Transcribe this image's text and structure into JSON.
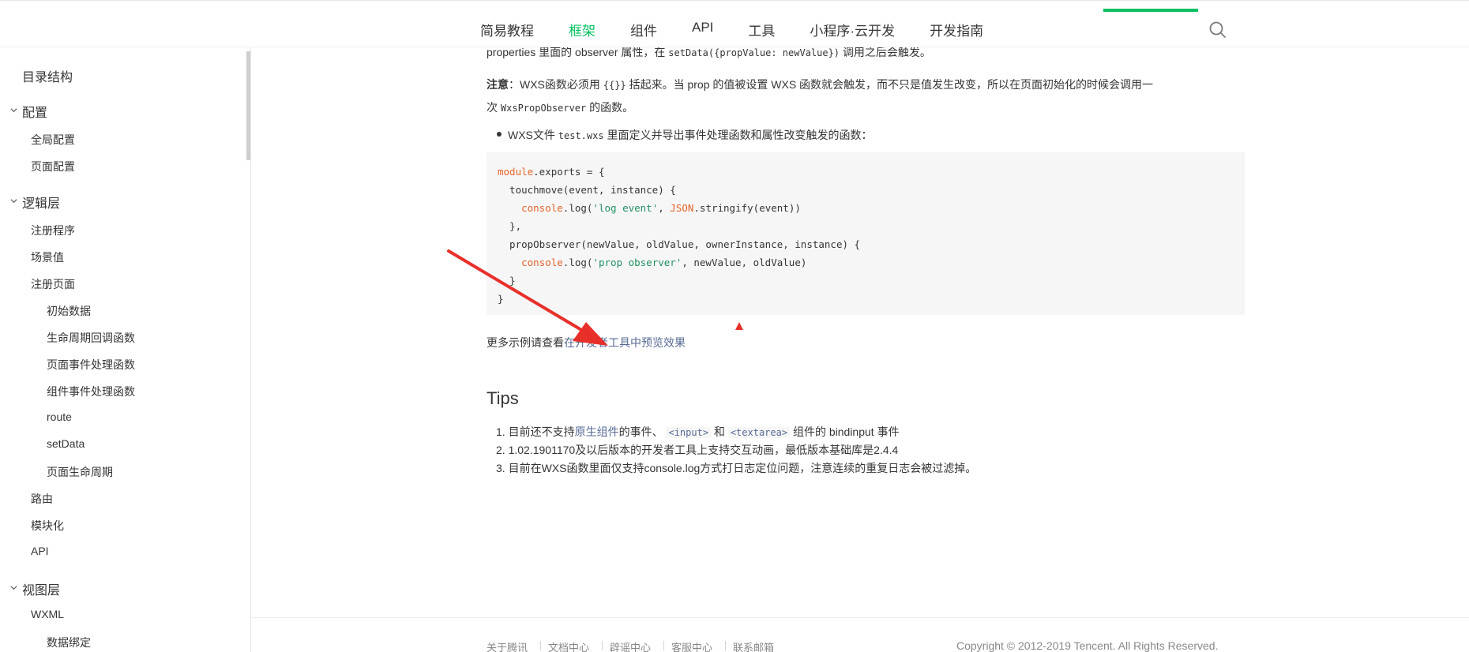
{
  "nav": {
    "items": [
      "简易教程",
      "框架",
      "组件",
      "API",
      "工具",
      "小程序·云开发",
      "开发指南"
    ],
    "active_index": 1
  },
  "sidebar": {
    "items": [
      {
        "label": "目录结构",
        "level": 0
      },
      {
        "label": "配置",
        "level": 0,
        "expanded": true
      },
      {
        "label": "全局配置",
        "level": 1
      },
      {
        "label": "页面配置",
        "level": 1
      },
      {
        "label": "逻辑层",
        "level": 0,
        "expanded": true
      },
      {
        "label": "注册程序",
        "level": 1
      },
      {
        "label": "场景值",
        "level": 1
      },
      {
        "label": "注册页面",
        "level": 1
      },
      {
        "label": "初始数据",
        "level": 2
      },
      {
        "label": "生命周期回调函数",
        "level": 2
      },
      {
        "label": "页面事件处理函数",
        "level": 2
      },
      {
        "label": "组件事件处理函数",
        "level": 2
      },
      {
        "label": "route",
        "level": 2
      },
      {
        "label": "setData",
        "level": 2
      },
      {
        "label": "页面生命周期",
        "level": 2
      },
      {
        "label": "路由",
        "level": 1
      },
      {
        "label": "模块化",
        "level": 1
      },
      {
        "label": "API",
        "level": 1
      },
      {
        "label": "视图层",
        "level": 0,
        "expanded": true
      },
      {
        "label": "WXML",
        "level": 1
      },
      {
        "label": "数据绑定",
        "level": 2
      }
    ]
  },
  "content": {
    "line0_a": "properties 里面的 observer 属性，在 ",
    "line0_code": "setData({propValue: newValue})",
    "line0_b": " 调用之后会触发。",
    "note_label": "注意",
    "note_a": "：WXS函数必须用 ",
    "note_code": "{{}}",
    "note_b": " 括起来。当 prop 的值被设置 WXS 函数就会触发，而不只是值发生改变，所以在页面初始化的时候会调用一",
    "note_c": "次 ",
    "note_code2": "WxsPropObserver",
    "note_d": " 的函数。",
    "bullet_a": "WXS文件 ",
    "bullet_code": "test.wxs",
    "bullet_b": " 里面定义并导出事件处理函数和属性改变触发的函数：",
    "code_lines": [
      {
        "kw": "module",
        "rest": ".exports = {"
      },
      {
        "plain": "  touchmove(event, instance) {"
      },
      {
        "indent": "    ",
        "kw": "console",
        "mid": ".log(",
        "str": "'log event'",
        "mid2": ", ",
        "kw2": "JSON",
        "rest": ".stringify(event))"
      },
      {
        "plain": "  },"
      },
      {
        "plain": "  propObserver(newValue, oldValue, ownerInstance, instance) {"
      },
      {
        "indent": "    ",
        "kw": "console",
        "mid": ".log(",
        "str": "'prop observer'",
        "rest": ", newValue, oldValue)"
      },
      {
        "plain": "  }"
      },
      {
        "plain": "}"
      }
    ],
    "more_a": "更多示例请查看",
    "more_link": "在开发者工具中预览效果",
    "tips_title": "Tips",
    "tips": [
      {
        "num": "1.",
        "a": "目前还不支持",
        "link": "原生组件",
        "b": "的事件、",
        "code1": "<input>",
        "c": " 和 ",
        "code2": "<textarea>",
        "d": " 组件的 bindinput 事件"
      },
      {
        "num": "2.",
        "a": "1.02.1901170及以后版本的开发者工具上支持交互动画，最低版本基础库是2.4.4"
      },
      {
        "num": "3.",
        "a": "目前在WXS函数里面仅支持console.log方式打日志定位问题，注意连续的重复日志会被过滤掉。"
      }
    ]
  },
  "footer": {
    "links": [
      "关于腾讯",
      "文档中心",
      "辟谣中心",
      "客服中心",
      "联系邮箱"
    ],
    "copyright": "Copyright © 2012-2019 Tencent. All Rights Reserved."
  },
  "colors": {
    "accent": "#07c160",
    "link": "#576b95",
    "annotation": "#e8302b"
  }
}
